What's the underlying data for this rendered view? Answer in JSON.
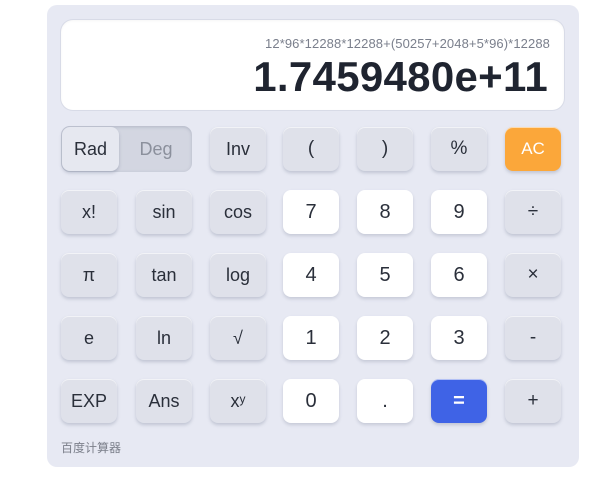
{
  "display": {
    "expression": "12*96*12288*12288+(50257+2048+5*96)*12288",
    "result": "1.7459480e+11"
  },
  "mode": {
    "active": "Rad",
    "inactive": "Deg"
  },
  "keys": {
    "inv": "Inv",
    "open_paren": "(",
    "close_paren": ")",
    "percent": "%",
    "ac": "AC",
    "factorial": "x!",
    "sin": "sin",
    "cos": "cos",
    "seven": "7",
    "eight": "8",
    "nine": "9",
    "divide": "÷",
    "pi": "π",
    "tan": "tan",
    "log": "log",
    "four": "4",
    "five": "5",
    "six": "6",
    "multiply": "×",
    "e": "e",
    "ln": "ln",
    "sqrt": "√",
    "one": "1",
    "two": "2",
    "three": "3",
    "minus": "-",
    "exp": "EXP",
    "ans": "Ans",
    "power_base": "x",
    "power_exp": "y",
    "zero": "0",
    "dot": ".",
    "equals": "=",
    "plus": "+"
  },
  "brand": "百度计算器",
  "colors": {
    "ac": "#fba73a",
    "equals": "#3f63e6",
    "panel": "#e7e9f3"
  }
}
